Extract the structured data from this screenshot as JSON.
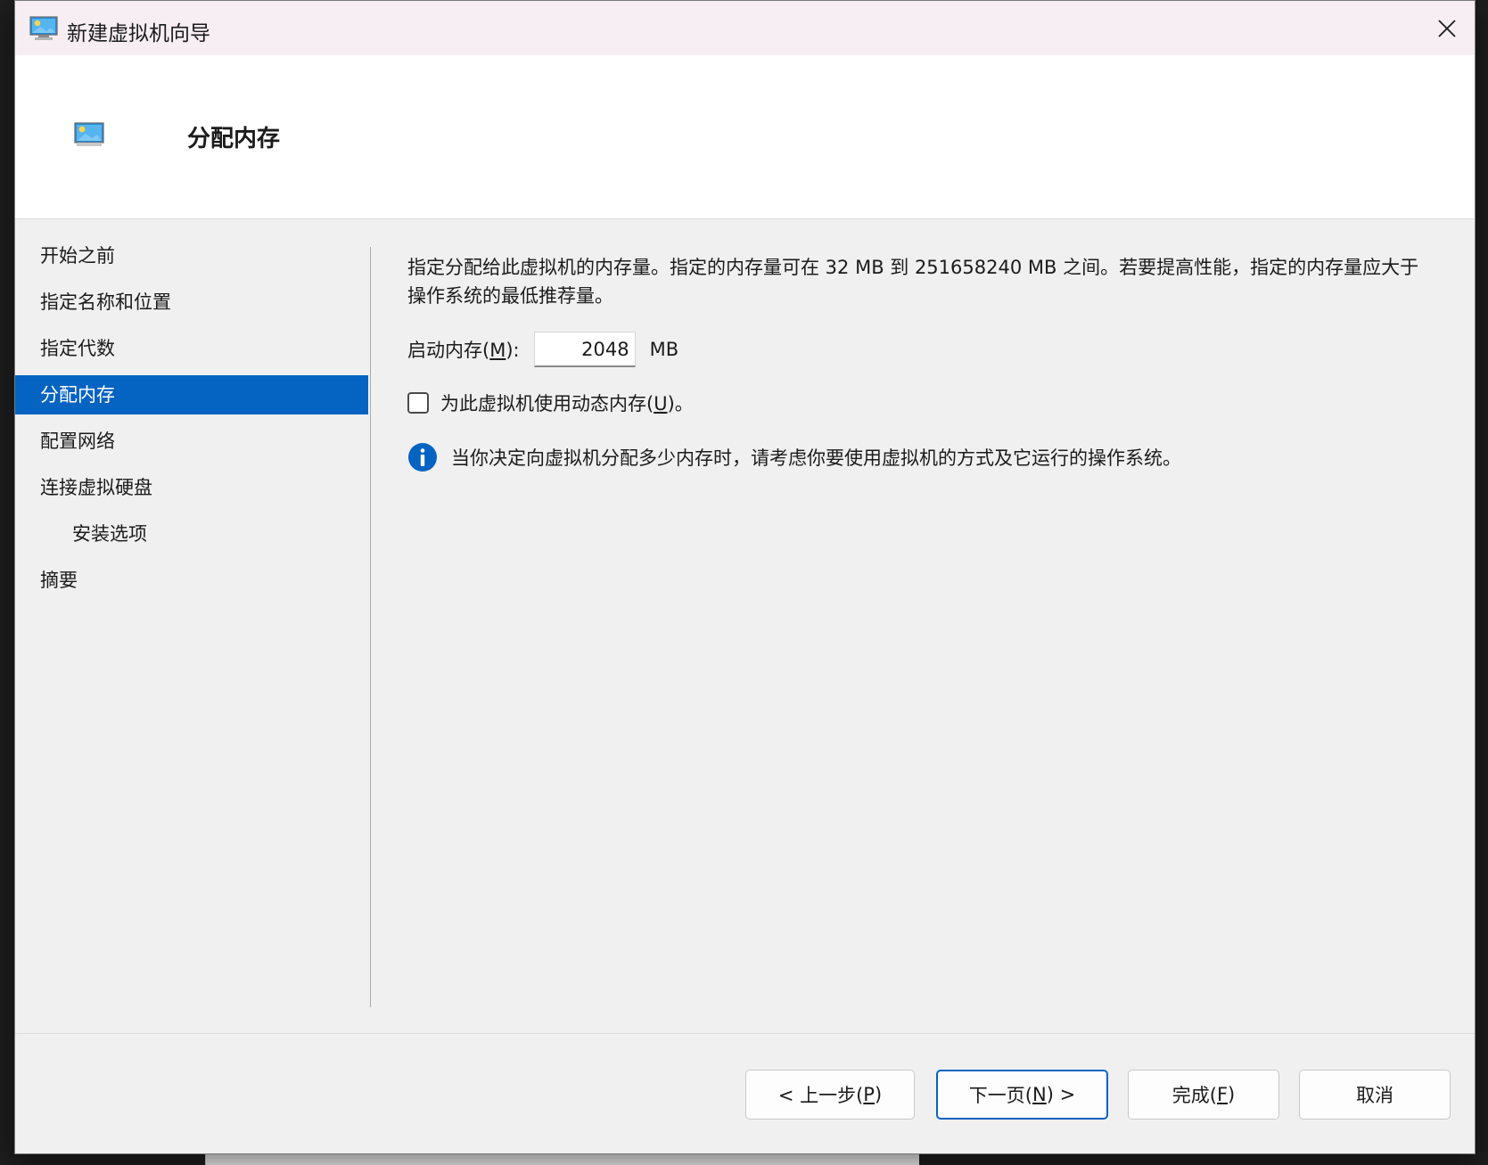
{
  "window": {
    "title": "新建虚拟机向导",
    "close_label": "✕"
  },
  "header": {
    "title": "分配内存"
  },
  "nav": {
    "items": [
      {
        "label": "开始之前",
        "active": false,
        "sub": false
      },
      {
        "label": "指定名称和位置",
        "active": false,
        "sub": false
      },
      {
        "label": "指定代数",
        "active": false,
        "sub": false
      },
      {
        "label": "分配内存",
        "active": true,
        "sub": false
      },
      {
        "label": "配置网络",
        "active": false,
        "sub": false
      },
      {
        "label": "连接虚拟硬盘",
        "active": false,
        "sub": false
      },
      {
        "label": "安装选项",
        "active": false,
        "sub": true
      },
      {
        "label": "摘要",
        "active": false,
        "sub": false
      }
    ]
  },
  "content": {
    "description": "指定分配给此虚拟机的内存量。指定的内存量可在 32 MB 到 251658240 MB 之间。若要提高性能，指定的内存量应大于操作系统的最低推荐量。",
    "startup_memory": {
      "label_prefix": "启动内存(",
      "mnemonic": "M",
      "label_suffix": "):",
      "value": "2048",
      "unit": "MB"
    },
    "dynamic_memory": {
      "label_prefix": "为此虚拟机使用动态内存(",
      "mnemonic": "U",
      "label_suffix": ")。",
      "checked": false
    },
    "info": {
      "text": "当你决定向虚拟机分配多少内存时，请考虑你要使用虚拟机的方式及它运行的操作系统。"
    }
  },
  "footer": {
    "prev": {
      "prefix": "< 上一步(",
      "mnemonic": "P",
      "suffix": ")"
    },
    "next": {
      "prefix": "下一页(",
      "mnemonic": "N",
      "suffix": ") >"
    },
    "finish": {
      "prefix": "完成(",
      "mnemonic": "F",
      "suffix": ")"
    },
    "cancel": {
      "label": "取消"
    }
  },
  "colors": {
    "accent": "#0563c1",
    "titlebar_bg": "#f6eef3",
    "dialog_bg": "#f0f0f0"
  }
}
